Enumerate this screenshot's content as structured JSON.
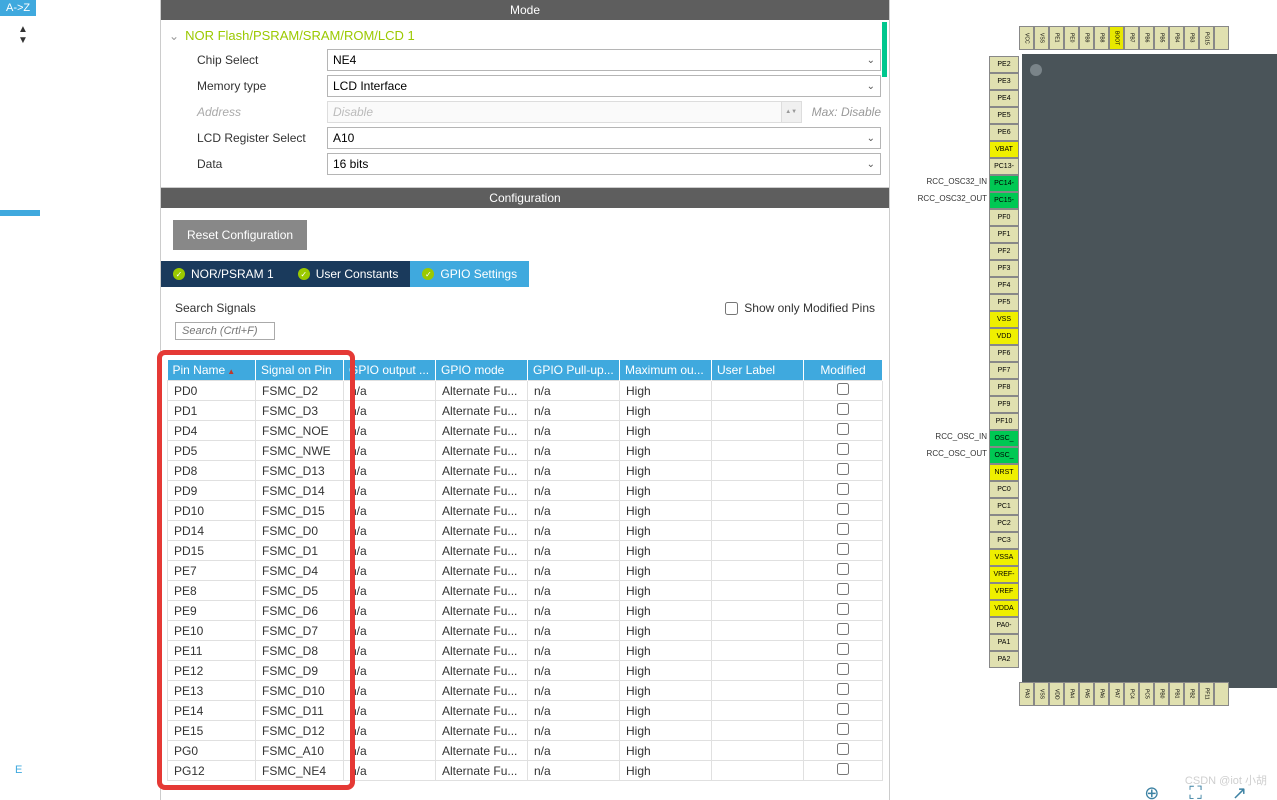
{
  "left": {
    "az": "A->Z",
    "e": "E"
  },
  "headers": {
    "mode": "Mode",
    "config": "Configuration"
  },
  "mode": {
    "collapse_title": "NOR Flash/PSRAM/SRAM/ROM/LCD 1",
    "chip_select": {
      "label": "Chip Select",
      "value": "NE4"
    },
    "memory_type": {
      "label": "Memory type",
      "value": "LCD Interface"
    },
    "address": {
      "label": "Address",
      "value": "Disable",
      "max": "Max: Disable"
    },
    "lcd_reg": {
      "label": "LCD Register Select",
      "value": "A10"
    },
    "data": {
      "label": "Data",
      "value": "16 bits"
    }
  },
  "config": {
    "reset_btn": "Reset Configuration"
  },
  "tabs": {
    "nor": "NOR/PSRAM 1",
    "user": "User Constants",
    "gpio": "GPIO Settings"
  },
  "search": {
    "label": "Search Signals",
    "placeholder": "Search (Crtl+F)",
    "show_modified": "Show only Modified Pins"
  },
  "columns": {
    "pin": "Pin Name",
    "signal": "Signal on Pin",
    "gpio_out": "GPIO output ...",
    "gpio_mode": "GPIO mode",
    "pull": "GPIO Pull-up...",
    "max": "Maximum ou...",
    "user_label": "User Label",
    "modified": "Modified"
  },
  "rows": [
    {
      "pin": "PD0",
      "signal": "FSMC_D2",
      "out": "n/a",
      "mode": "Alternate Fu...",
      "pull": "n/a",
      "max": "High"
    },
    {
      "pin": "PD1",
      "signal": "FSMC_D3",
      "out": "n/a",
      "mode": "Alternate Fu...",
      "pull": "n/a",
      "max": "High"
    },
    {
      "pin": "PD4",
      "signal": "FSMC_NOE",
      "out": "n/a",
      "mode": "Alternate Fu...",
      "pull": "n/a",
      "max": "High"
    },
    {
      "pin": "PD5",
      "signal": "FSMC_NWE",
      "out": "n/a",
      "mode": "Alternate Fu...",
      "pull": "n/a",
      "max": "High"
    },
    {
      "pin": "PD8",
      "signal": "FSMC_D13",
      "out": "n/a",
      "mode": "Alternate Fu...",
      "pull": "n/a",
      "max": "High"
    },
    {
      "pin": "PD9",
      "signal": "FSMC_D14",
      "out": "n/a",
      "mode": "Alternate Fu...",
      "pull": "n/a",
      "max": "High"
    },
    {
      "pin": "PD10",
      "signal": "FSMC_D15",
      "out": "n/a",
      "mode": "Alternate Fu...",
      "pull": "n/a",
      "max": "High"
    },
    {
      "pin": "PD14",
      "signal": "FSMC_D0",
      "out": "n/a",
      "mode": "Alternate Fu...",
      "pull": "n/a",
      "max": "High"
    },
    {
      "pin": "PD15",
      "signal": "FSMC_D1",
      "out": "n/a",
      "mode": "Alternate Fu...",
      "pull": "n/a",
      "max": "High"
    },
    {
      "pin": "PE7",
      "signal": "FSMC_D4",
      "out": "n/a",
      "mode": "Alternate Fu...",
      "pull": "n/a",
      "max": "High"
    },
    {
      "pin": "PE8",
      "signal": "FSMC_D5",
      "out": "n/a",
      "mode": "Alternate Fu...",
      "pull": "n/a",
      "max": "High"
    },
    {
      "pin": "PE9",
      "signal": "FSMC_D6",
      "out": "n/a",
      "mode": "Alternate Fu...",
      "pull": "n/a",
      "max": "High"
    },
    {
      "pin": "PE10",
      "signal": "FSMC_D7",
      "out": "n/a",
      "mode": "Alternate Fu...",
      "pull": "n/a",
      "max": "High"
    },
    {
      "pin": "PE11",
      "signal": "FSMC_D8",
      "out": "n/a",
      "mode": "Alternate Fu...",
      "pull": "n/a",
      "max": "High"
    },
    {
      "pin": "PE12",
      "signal": "FSMC_D9",
      "out": "n/a",
      "mode": "Alternate Fu...",
      "pull": "n/a",
      "max": "High"
    },
    {
      "pin": "PE13",
      "signal": "FSMC_D10",
      "out": "n/a",
      "mode": "Alternate Fu...",
      "pull": "n/a",
      "max": "High"
    },
    {
      "pin": "PE14",
      "signal": "FSMC_D11",
      "out": "n/a",
      "mode": "Alternate Fu...",
      "pull": "n/a",
      "max": "High"
    },
    {
      "pin": "PE15",
      "signal": "FSMC_D12",
      "out": "n/a",
      "mode": "Alternate Fu...",
      "pull": "n/a",
      "max": "High"
    },
    {
      "pin": "PG0",
      "signal": "FSMC_A10",
      "out": "n/a",
      "mode": "Alternate Fu...",
      "pull": "n/a",
      "max": "High"
    },
    {
      "pin": "PG12",
      "signal": "FSMC_NE4",
      "out": "n/a",
      "mode": "Alternate Fu...",
      "pull": "n/a",
      "max": "High"
    }
  ],
  "chip": {
    "top_pins": [
      "VCC",
      "VSS",
      "PE1",
      "PE0",
      "PB9",
      "PB8",
      "BOOT",
      "PB7",
      "PB6",
      "PB5",
      "PB4",
      "PB3",
      "PG15",
      ""
    ],
    "side_pins": [
      {
        "n": "PE2"
      },
      {
        "n": "PE3"
      },
      {
        "n": "PE4"
      },
      {
        "n": "PE5"
      },
      {
        "n": "PE6"
      },
      {
        "n": "VBAT",
        "c": "yellow"
      },
      {
        "n": "PC13-"
      },
      {
        "n": "PC14-",
        "c": "green",
        "l": "RCC_OSC32_IN"
      },
      {
        "n": "PC15-",
        "c": "green",
        "l": "RCC_OSC32_OUT"
      },
      {
        "n": "PF0"
      },
      {
        "n": "PF1"
      },
      {
        "n": "PF2"
      },
      {
        "n": "PF3"
      },
      {
        "n": "PF4"
      },
      {
        "n": "PF5"
      },
      {
        "n": "VSS",
        "c": "yellow"
      },
      {
        "n": "VDD",
        "c": "yellow"
      },
      {
        "n": "PF6"
      },
      {
        "n": "PF7"
      },
      {
        "n": "PF8"
      },
      {
        "n": "PF9"
      },
      {
        "n": "PF10"
      },
      {
        "n": "OSC_",
        "c": "green",
        "l": "RCC_OSC_IN"
      },
      {
        "n": "OSC_",
        "c": "green",
        "l": "RCC_OSC_OUT"
      },
      {
        "n": "NRST",
        "c": "yellow"
      },
      {
        "n": "PC0"
      },
      {
        "n": "PC1"
      },
      {
        "n": "PC2"
      },
      {
        "n": "PC3"
      },
      {
        "n": "VSSA",
        "c": "yellow"
      },
      {
        "n": "VREF-",
        "c": "yellow"
      },
      {
        "n": "VREF",
        "c": "yellow"
      },
      {
        "n": "VDDA",
        "c": "yellow"
      },
      {
        "n": "PA0-"
      },
      {
        "n": "PA1"
      },
      {
        "n": "PA2"
      }
    ],
    "bottom_pins": [
      "PA3",
      "VSS",
      "VDD",
      "PA4",
      "PA5",
      "PA6",
      "PA7",
      "PC4",
      "PC5",
      "PB0",
      "PB1",
      "PB2",
      "PF11",
      ""
    ]
  },
  "watermark": "CSDN @iot 小胡"
}
